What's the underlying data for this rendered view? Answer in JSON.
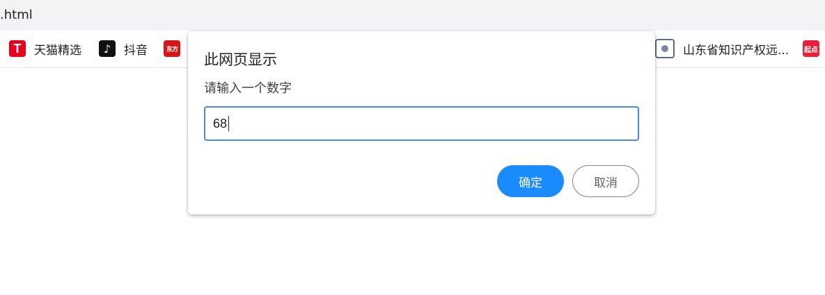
{
  "address_bar": {
    "url_fragment": ".html"
  },
  "bookmarks": [
    {
      "label": "天猫精选",
      "icon": "tmall-icon",
      "glyph": "T"
    },
    {
      "label": "抖音",
      "icon": "douyin-icon",
      "glyph": "♪"
    },
    {
      "label": "",
      "icon": "dongfang-icon",
      "glyph": "东方"
    },
    {
      "label": "山东省知识产权远...",
      "icon": "gov-emblem-icon",
      "glyph": ""
    },
    {
      "label": "",
      "icon": "qidian-icon",
      "glyph": "起点"
    }
  ],
  "dialog": {
    "title": "此网页显示",
    "message": "请输入一个数字",
    "input_value": "68",
    "ok_label": "确定",
    "cancel_label": "取消"
  },
  "colors": {
    "accent": "#1a8cff",
    "input_focus_border": "#4a86e8",
    "toolbar_bg": "#f1f3f4"
  }
}
